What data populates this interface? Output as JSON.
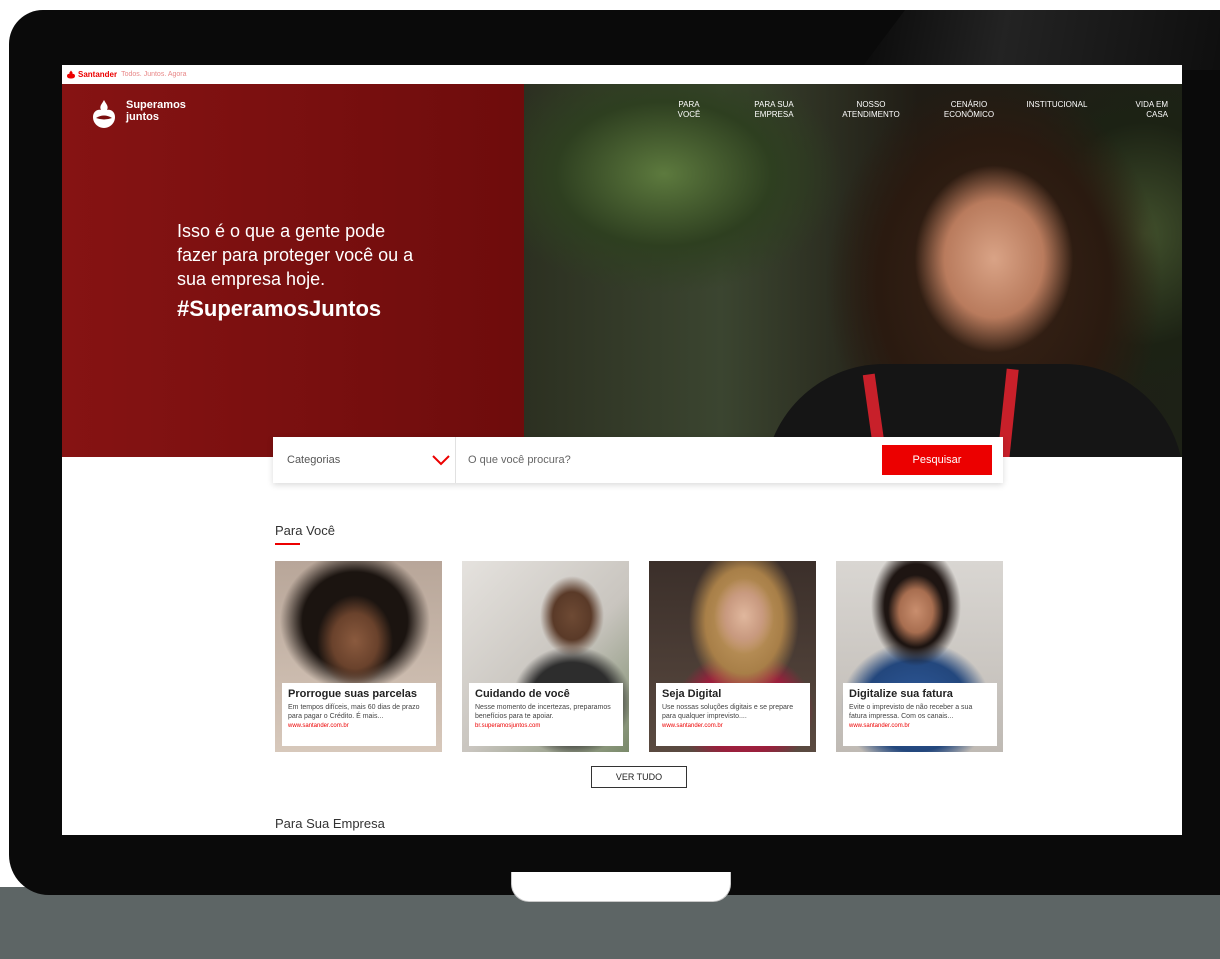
{
  "brandbar": {
    "name": "Santander",
    "tagline": "Todos. Juntos. Agora"
  },
  "logo": {
    "line1": "Superamos",
    "line2": "juntos"
  },
  "nav": [
    {
      "line1": "PARA",
      "line2": "VOCÊ"
    },
    {
      "line1": "PARA SUA",
      "line2": "EMPRESA"
    },
    {
      "line1": "NOSSO",
      "line2": "ATENDIMENTO"
    },
    {
      "line1": "CENÁRIO",
      "line2": "ECONÔMICO"
    },
    {
      "line1": "INSTITUCIONAL",
      "line2": ""
    },
    {
      "line1": "VIDA EM",
      "line2": "CASA"
    }
  ],
  "hero": {
    "line1": "Isso é o que a gente pode",
    "line2": "fazer para proteger você ou a",
    "line3": "sua empresa hoje.",
    "hashtag": "#SuperamosJuntos"
  },
  "search": {
    "category_label": "Categorias",
    "placeholder": "O que você procura?",
    "button_label": "Pesquisar"
  },
  "sections": {
    "para_voce": "Para Você",
    "para_sua_empresa": "Para Sua Empresa"
  },
  "cards": [
    {
      "title": "Prorrogue suas parcelas",
      "desc": "Em tempos difíceis, mais 60 dias de prazo para pagar o Crédito. É mais...",
      "link": "www.santander.com.br"
    },
    {
      "title": "Cuidando de você",
      "desc": "Nesse momento de incertezas, preparamos benefícios para te apoiar.",
      "link": "br.superamosjuntos.com"
    },
    {
      "title": "Seja Digital",
      "desc": "Use nossas soluções digitais e se prepare para qualquer imprevisto....",
      "link": "www.santander.com.br"
    },
    {
      "title": "Digitalize sua fatura",
      "desc": "Evite o imprevisto de não receber a sua fatura impressa. Com os canais...",
      "link": "www.santander.com.br"
    }
  ],
  "ver_tudo_label": "VER TUDO",
  "colors": {
    "brand_red": "#ec0000",
    "hero_red": "#7d1010"
  }
}
